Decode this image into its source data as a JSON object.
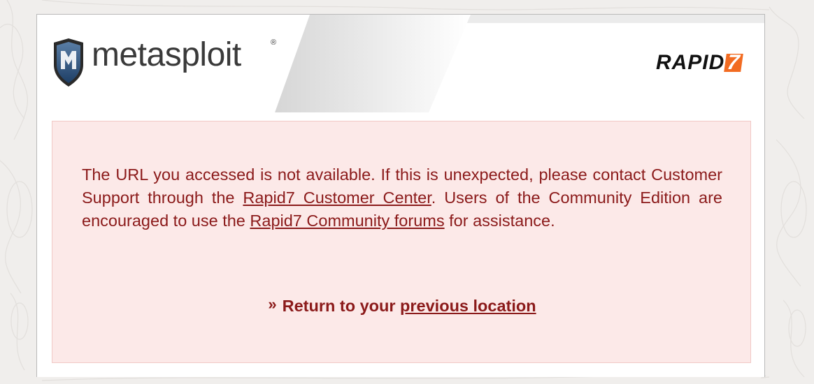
{
  "brand": {
    "logo_text": "metasploit",
    "logo_mark": "®",
    "partner_logo_text": "RAPID",
    "partner_logo_mark": "7",
    "shield_letter": "M",
    "accent_color": "#f26b21",
    "error_text_color": "#8b1a1a",
    "error_bg_color": "#fce9e8"
  },
  "message": {
    "part1": "The URL you accessed is not available. If this is unexpected, please contact Customer Support through the ",
    "link1": "Rapid7 Customer Center",
    "part2": ". Users of the Community Edition are encouraged to use the ",
    "link2": "Rapid7 Community forums",
    "part3": " for assistance."
  },
  "return_link": {
    "icon": "double-chevron-right-icon",
    "glyph": "»",
    "prefix": "Return to your ",
    "link_text": "previous location"
  }
}
